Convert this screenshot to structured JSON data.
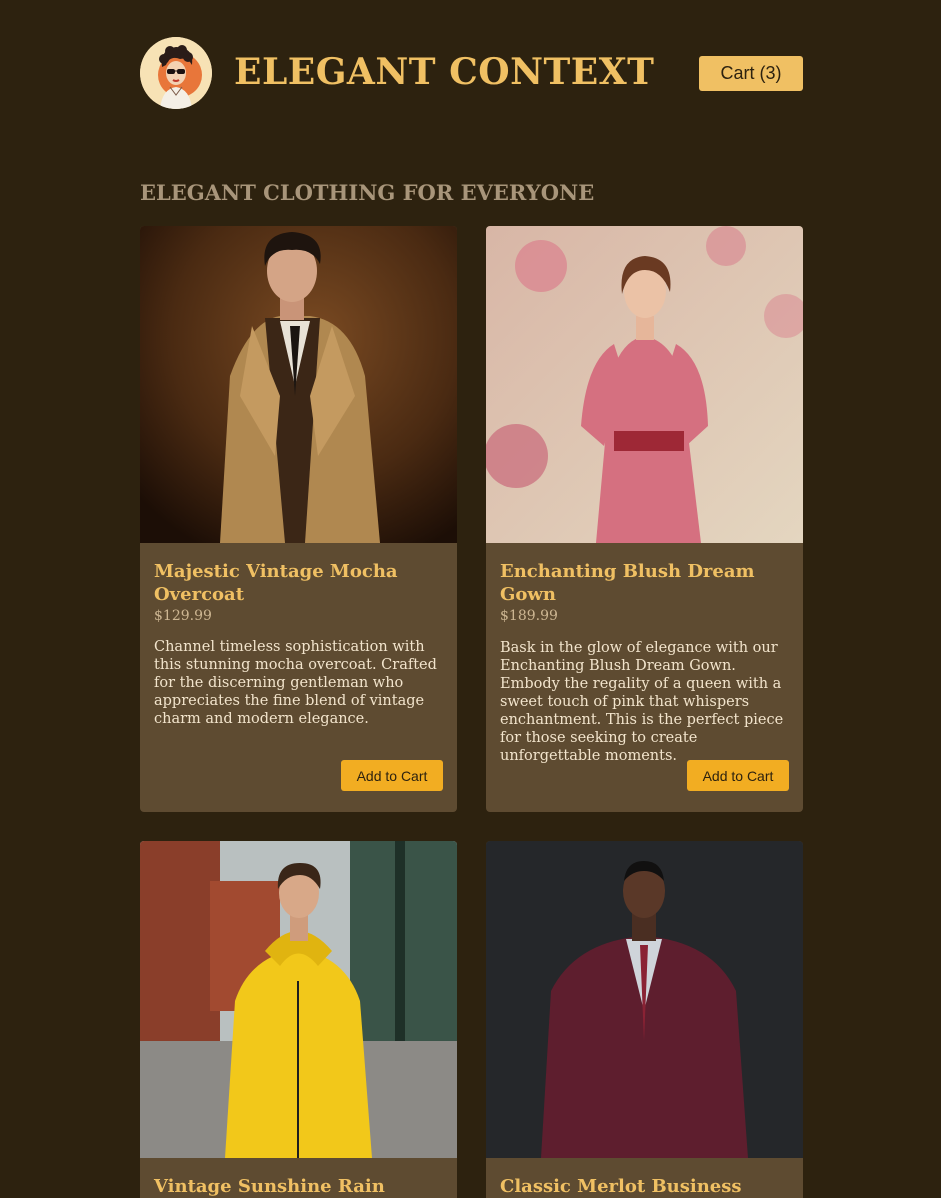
{
  "header": {
    "brand": "ELEGANT CONTEXT",
    "cart_label": "Cart (3)",
    "logo_icon": "vintage-woman-sunglasses-avatar"
  },
  "section": {
    "title": "ELEGANT CLOTHING FOR EVERYONE"
  },
  "colors": {
    "background": "#2d220f",
    "card": "#5e4b31",
    "accent": "#f0c063",
    "button": "#f2ad22"
  },
  "products": [
    {
      "name": "Majestic Vintage Mocha Overcoat",
      "price": "$129.99",
      "description": "Channel timeless sophistication with this stunning mocha overcoat. Crafted for the discerning gentleman who appreciates the fine blend of vintage charm and modern elegance.",
      "button": "Add to Cart"
    },
    {
      "name": "Enchanting Blush Dream Gown",
      "price": "$189.99",
      "description": "Bask in the glow of elegance with our Enchanting Blush Dream Gown. Embody the regality of a queen with a sweet touch of pink that whispers enchantment. This is the perfect piece for those seeking to create unforgettable moments.",
      "button": "Add to Cart"
    },
    {
      "name": "Vintage Sunshine Rain Jacket",
      "price": "",
      "description": "",
      "button": ""
    },
    {
      "name": "Classic Merlot Business Suit",
      "price": "",
      "description": "",
      "button": ""
    }
  ]
}
